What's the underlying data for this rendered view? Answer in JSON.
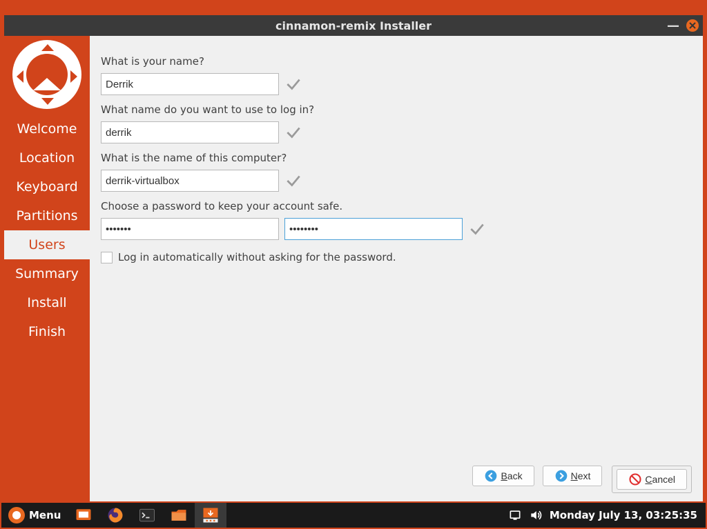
{
  "window": {
    "title": "cinnamon-remix Installer"
  },
  "sidebar": {
    "items": [
      {
        "label": "Welcome",
        "active": false
      },
      {
        "label": "Location",
        "active": false
      },
      {
        "label": "Keyboard",
        "active": false
      },
      {
        "label": "Partitions",
        "active": false
      },
      {
        "label": "Users",
        "active": true
      },
      {
        "label": "Summary",
        "active": false
      },
      {
        "label": "Install",
        "active": false
      },
      {
        "label": "Finish",
        "active": false
      }
    ]
  },
  "form": {
    "name_label": "What is your name?",
    "name_value": "Derrik",
    "login_label": "What name do you want to use to log in?",
    "login_value": "derrik",
    "computer_label": "What is the name of this computer?",
    "computer_value": "derrik-virtualbox",
    "password_label": "Choose a password to keep your account safe.",
    "password1_value": "•••••••",
    "password2_value": "••••••••",
    "autologin_label": "Log in automatically without asking for the password."
  },
  "buttons": {
    "back_prefix": "B",
    "back_rest": "ack",
    "next_prefix": "N",
    "next_rest": "ext",
    "cancel_prefix": "C",
    "cancel_rest": "ancel"
  },
  "taskbar": {
    "menu_label": "Menu",
    "datetime": "Monday July 13, 03:25:35"
  }
}
